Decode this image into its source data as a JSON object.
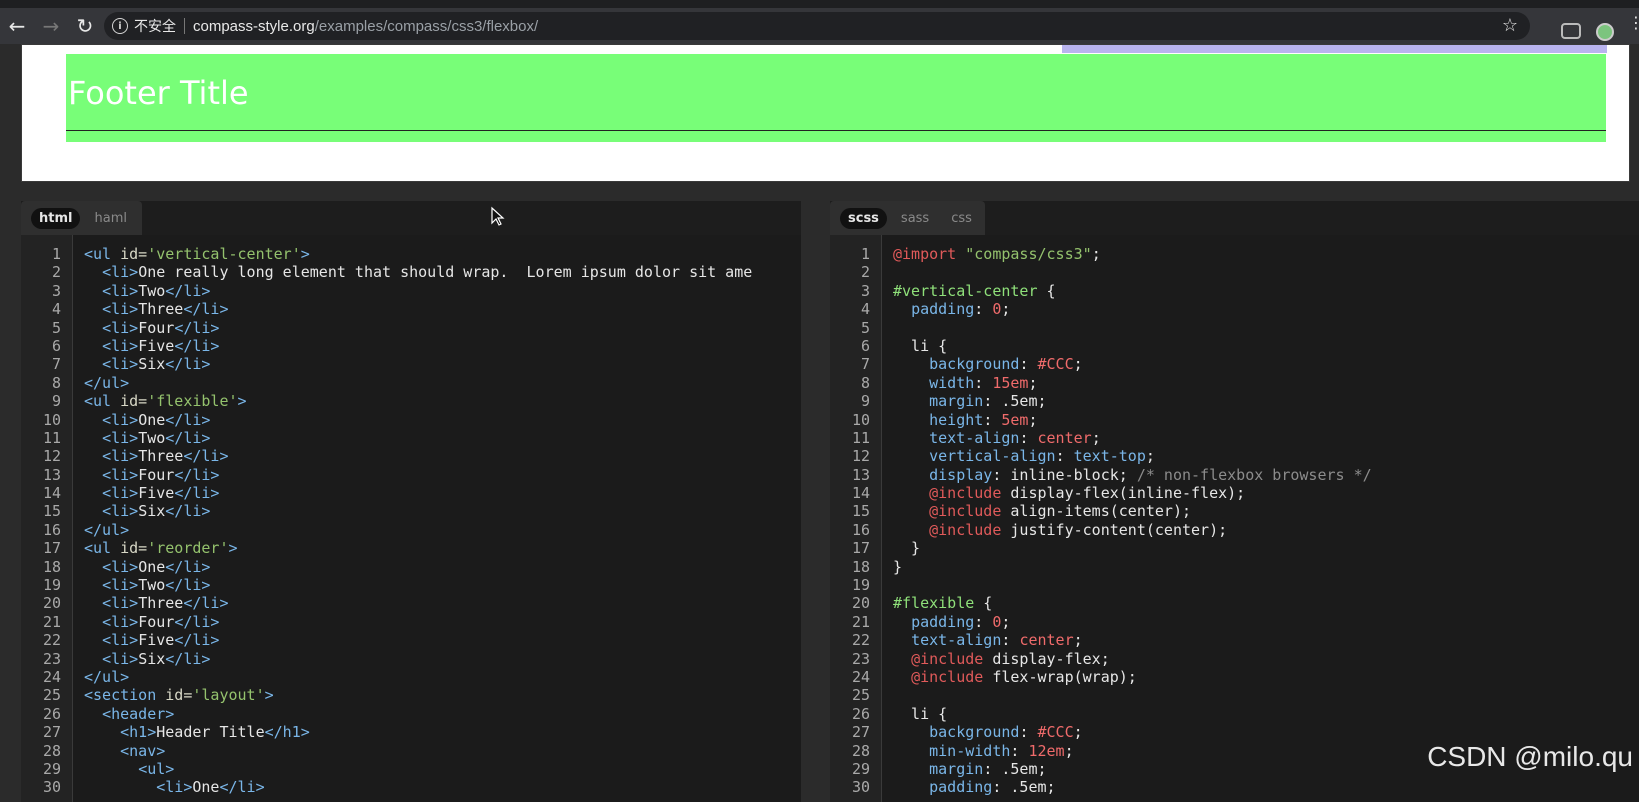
{
  "browser": {
    "back_icon": "back-arrow-icon",
    "forward_icon": "forward-arrow-icon",
    "reload_icon": "reload-icon",
    "security_label": "不安全",
    "url_host": "compass-style.org",
    "url_path": "/examples/compass/css3/flexbox/"
  },
  "preview": {
    "footer_title": "Footer Title",
    "colors": {
      "footer_bg": "#78fe78",
      "accent_bar": "#b9b4ef"
    }
  },
  "html_pane": {
    "tabs": [
      {
        "label": "html",
        "active": true
      },
      {
        "label": "haml",
        "active": false
      }
    ],
    "lines": [
      {
        "n": "1",
        "tokens": [
          [
            "tag",
            "<ul "
          ],
          [
            "attr",
            "id="
          ],
          [
            "str",
            "'vertical-center'"
          ],
          [
            "tag",
            ">"
          ]
        ]
      },
      {
        "n": "2",
        "tokens": [
          [
            "txt",
            "  "
          ],
          [
            "tag",
            "<li>"
          ],
          [
            "txt",
            "One really long element that should wrap.  Lorem ipsum dolor sit ame"
          ]
        ]
      },
      {
        "n": "3",
        "tokens": [
          [
            "txt",
            "  "
          ],
          [
            "tag",
            "<li>"
          ],
          [
            "txt",
            "Two"
          ],
          [
            "tag",
            "</li>"
          ]
        ]
      },
      {
        "n": "4",
        "tokens": [
          [
            "txt",
            "  "
          ],
          [
            "tag",
            "<li>"
          ],
          [
            "txt",
            "Three"
          ],
          [
            "tag",
            "</li>"
          ]
        ]
      },
      {
        "n": "5",
        "tokens": [
          [
            "txt",
            "  "
          ],
          [
            "tag",
            "<li>"
          ],
          [
            "txt",
            "Four"
          ],
          [
            "tag",
            "</li>"
          ]
        ]
      },
      {
        "n": "6",
        "tokens": [
          [
            "txt",
            "  "
          ],
          [
            "tag",
            "<li>"
          ],
          [
            "txt",
            "Five"
          ],
          [
            "tag",
            "</li>"
          ]
        ]
      },
      {
        "n": "7",
        "tokens": [
          [
            "txt",
            "  "
          ],
          [
            "tag",
            "<li>"
          ],
          [
            "txt",
            "Six"
          ],
          [
            "tag",
            "</li>"
          ]
        ]
      },
      {
        "n": "8",
        "tokens": [
          [
            "tag",
            "</ul>"
          ]
        ]
      },
      {
        "n": "9",
        "tokens": [
          [
            "tag",
            "<ul "
          ],
          [
            "attr",
            "id="
          ],
          [
            "str",
            "'flexible'"
          ],
          [
            "tag",
            ">"
          ]
        ]
      },
      {
        "n": "10",
        "tokens": [
          [
            "txt",
            "  "
          ],
          [
            "tag",
            "<li>"
          ],
          [
            "txt",
            "One"
          ],
          [
            "tag",
            "</li>"
          ]
        ]
      },
      {
        "n": "11",
        "tokens": [
          [
            "txt",
            "  "
          ],
          [
            "tag",
            "<li>"
          ],
          [
            "txt",
            "Two"
          ],
          [
            "tag",
            "</li>"
          ]
        ]
      },
      {
        "n": "12",
        "tokens": [
          [
            "txt",
            "  "
          ],
          [
            "tag",
            "<li>"
          ],
          [
            "txt",
            "Three"
          ],
          [
            "tag",
            "</li>"
          ]
        ]
      },
      {
        "n": "13",
        "tokens": [
          [
            "txt",
            "  "
          ],
          [
            "tag",
            "<li>"
          ],
          [
            "txt",
            "Four"
          ],
          [
            "tag",
            "</li>"
          ]
        ]
      },
      {
        "n": "14",
        "tokens": [
          [
            "txt",
            "  "
          ],
          [
            "tag",
            "<li>"
          ],
          [
            "txt",
            "Five"
          ],
          [
            "tag",
            "</li>"
          ]
        ]
      },
      {
        "n": "15",
        "tokens": [
          [
            "txt",
            "  "
          ],
          [
            "tag",
            "<li>"
          ],
          [
            "txt",
            "Six"
          ],
          [
            "tag",
            "</li>"
          ]
        ]
      },
      {
        "n": "16",
        "tokens": [
          [
            "tag",
            "</ul>"
          ]
        ]
      },
      {
        "n": "17",
        "tokens": [
          [
            "tag",
            "<ul "
          ],
          [
            "attr",
            "id="
          ],
          [
            "str",
            "'reorder'"
          ],
          [
            "tag",
            ">"
          ]
        ]
      },
      {
        "n": "18",
        "tokens": [
          [
            "txt",
            "  "
          ],
          [
            "tag",
            "<li>"
          ],
          [
            "txt",
            "One"
          ],
          [
            "tag",
            "</li>"
          ]
        ]
      },
      {
        "n": "19",
        "tokens": [
          [
            "txt",
            "  "
          ],
          [
            "tag",
            "<li>"
          ],
          [
            "txt",
            "Two"
          ],
          [
            "tag",
            "</li>"
          ]
        ]
      },
      {
        "n": "20",
        "tokens": [
          [
            "txt",
            "  "
          ],
          [
            "tag",
            "<li>"
          ],
          [
            "txt",
            "Three"
          ],
          [
            "tag",
            "</li>"
          ]
        ]
      },
      {
        "n": "21",
        "tokens": [
          [
            "txt",
            "  "
          ],
          [
            "tag",
            "<li>"
          ],
          [
            "txt",
            "Four"
          ],
          [
            "tag",
            "</li>"
          ]
        ]
      },
      {
        "n": "22",
        "tokens": [
          [
            "txt",
            "  "
          ],
          [
            "tag",
            "<li>"
          ],
          [
            "txt",
            "Five"
          ],
          [
            "tag",
            "</li>"
          ]
        ]
      },
      {
        "n": "23",
        "tokens": [
          [
            "txt",
            "  "
          ],
          [
            "tag",
            "<li>"
          ],
          [
            "txt",
            "Six"
          ],
          [
            "tag",
            "</li>"
          ]
        ]
      },
      {
        "n": "24",
        "tokens": [
          [
            "tag",
            "</ul>"
          ]
        ]
      },
      {
        "n": "25",
        "tokens": [
          [
            "tag",
            "<section "
          ],
          [
            "attr",
            "id="
          ],
          [
            "str",
            "'layout'"
          ],
          [
            "tag",
            ">"
          ]
        ]
      },
      {
        "n": "26",
        "tokens": [
          [
            "txt",
            "  "
          ],
          [
            "tag",
            "<header>"
          ]
        ]
      },
      {
        "n": "27",
        "tokens": [
          [
            "txt",
            "    "
          ],
          [
            "tag",
            "<h1>"
          ],
          [
            "txt",
            "Header Title"
          ],
          [
            "tag",
            "</h1>"
          ]
        ]
      },
      {
        "n": "28",
        "tokens": [
          [
            "txt",
            "    "
          ],
          [
            "tag",
            "<nav>"
          ]
        ]
      },
      {
        "n": "29",
        "tokens": [
          [
            "txt",
            "      "
          ],
          [
            "tag",
            "<ul>"
          ]
        ]
      },
      {
        "n": "30",
        "tokens": [
          [
            "txt",
            "        "
          ],
          [
            "tag",
            "<li>"
          ],
          [
            "txt",
            "One"
          ],
          [
            "tag",
            "</li>"
          ]
        ]
      }
    ]
  },
  "css_pane": {
    "tabs": [
      {
        "label": "scss",
        "active": true
      },
      {
        "label": "sass",
        "active": false
      },
      {
        "label": "css",
        "active": false
      }
    ],
    "lines": [
      {
        "n": "1",
        "tokens": [
          [
            "at",
            "@import "
          ],
          [
            "str",
            "\"compass/css3\""
          ],
          [
            "plain",
            ";"
          ]
        ]
      },
      {
        "n": "2",
        "tokens": []
      },
      {
        "n": "3",
        "tokens": [
          [
            "sel",
            "#vertical-center"
          ],
          [
            "plain",
            " {"
          ]
        ]
      },
      {
        "n": "4",
        "tokens": [
          [
            "plain",
            "  "
          ],
          [
            "prop",
            "padding"
          ],
          [
            "plain",
            ": "
          ],
          [
            "val",
            "0"
          ],
          [
            "plain",
            ";"
          ]
        ]
      },
      {
        "n": "5",
        "tokens": []
      },
      {
        "n": "6",
        "tokens": [
          [
            "plain",
            "  li {"
          ]
        ]
      },
      {
        "n": "7",
        "tokens": [
          [
            "plain",
            "    "
          ],
          [
            "prop",
            "background"
          ],
          [
            "plain",
            ": "
          ],
          [
            "val",
            "#CCC"
          ],
          [
            "plain",
            ";"
          ]
        ]
      },
      {
        "n": "8",
        "tokens": [
          [
            "plain",
            "    "
          ],
          [
            "prop",
            "width"
          ],
          [
            "plain",
            ": "
          ],
          [
            "val",
            "15em"
          ],
          [
            "plain",
            ";"
          ]
        ]
      },
      {
        "n": "9",
        "tokens": [
          [
            "plain",
            "    "
          ],
          [
            "prop",
            "margin"
          ],
          [
            "plain",
            ": .5em;"
          ]
        ]
      },
      {
        "n": "10",
        "tokens": [
          [
            "plain",
            "    "
          ],
          [
            "prop",
            "height"
          ],
          [
            "plain",
            ": "
          ],
          [
            "val",
            "5em"
          ],
          [
            "plain",
            ";"
          ]
        ]
      },
      {
        "n": "11",
        "tokens": [
          [
            "plain",
            "    "
          ],
          [
            "prop",
            "text-align"
          ],
          [
            "plain",
            ": "
          ],
          [
            "val",
            "center"
          ],
          [
            "plain",
            ";"
          ]
        ]
      },
      {
        "n": "12",
        "tokens": [
          [
            "plain",
            "    "
          ],
          [
            "prop",
            "vertical-align"
          ],
          [
            "plain",
            ": "
          ],
          [
            "prop",
            "text-top"
          ],
          [
            "plain",
            ";"
          ]
        ]
      },
      {
        "n": "13",
        "tokens": [
          [
            "plain",
            "    "
          ],
          [
            "prop",
            "display"
          ],
          [
            "plain",
            ": inline-block; "
          ],
          [
            "cmt",
            "/* non-flexbox browsers */"
          ]
        ]
      },
      {
        "n": "14",
        "tokens": [
          [
            "plain",
            "    "
          ],
          [
            "at",
            "@include"
          ],
          [
            "plain",
            " display-flex(inline-flex);"
          ]
        ]
      },
      {
        "n": "15",
        "tokens": [
          [
            "plain",
            "    "
          ],
          [
            "at",
            "@include"
          ],
          [
            "plain",
            " align-items(center);"
          ]
        ]
      },
      {
        "n": "16",
        "tokens": [
          [
            "plain",
            "    "
          ],
          [
            "at",
            "@include"
          ],
          [
            "plain",
            " justify-content(center);"
          ]
        ]
      },
      {
        "n": "17",
        "tokens": [
          [
            "plain",
            "  }"
          ]
        ]
      },
      {
        "n": "18",
        "tokens": [
          [
            "plain",
            "}"
          ]
        ]
      },
      {
        "n": "19",
        "tokens": []
      },
      {
        "n": "20",
        "tokens": [
          [
            "sel",
            "#flexible"
          ],
          [
            "plain",
            " {"
          ]
        ]
      },
      {
        "n": "21",
        "tokens": [
          [
            "plain",
            "  "
          ],
          [
            "prop",
            "padding"
          ],
          [
            "plain",
            ": "
          ],
          [
            "val",
            "0"
          ],
          [
            "plain",
            ";"
          ]
        ]
      },
      {
        "n": "22",
        "tokens": [
          [
            "plain",
            "  "
          ],
          [
            "prop",
            "text-align"
          ],
          [
            "plain",
            ": "
          ],
          [
            "val",
            "center"
          ],
          [
            "plain",
            ";"
          ]
        ]
      },
      {
        "n": "23",
        "tokens": [
          [
            "plain",
            "  "
          ],
          [
            "at",
            "@include"
          ],
          [
            "plain",
            " display-flex;"
          ]
        ]
      },
      {
        "n": "24",
        "tokens": [
          [
            "plain",
            "  "
          ],
          [
            "at",
            "@include"
          ],
          [
            "plain",
            " flex-wrap(wrap);"
          ]
        ]
      },
      {
        "n": "25",
        "tokens": []
      },
      {
        "n": "26",
        "tokens": [
          [
            "plain",
            "  li {"
          ]
        ]
      },
      {
        "n": "27",
        "tokens": [
          [
            "plain",
            "    "
          ],
          [
            "prop",
            "background"
          ],
          [
            "plain",
            ": "
          ],
          [
            "val",
            "#CCC"
          ],
          [
            "plain",
            ";"
          ]
        ]
      },
      {
        "n": "28",
        "tokens": [
          [
            "plain",
            "    "
          ],
          [
            "prop",
            "min-width"
          ],
          [
            "plain",
            ": "
          ],
          [
            "val",
            "12em"
          ],
          [
            "plain",
            ";"
          ]
        ]
      },
      {
        "n": "29",
        "tokens": [
          [
            "plain",
            "    "
          ],
          [
            "prop",
            "margin"
          ],
          [
            "plain",
            ": .5em;"
          ]
        ]
      },
      {
        "n": "30",
        "tokens": [
          [
            "plain",
            "    "
          ],
          [
            "prop",
            "padding"
          ],
          [
            "plain",
            ": .5em;"
          ]
        ]
      }
    ]
  },
  "watermark": "CSDN @milo.qu"
}
